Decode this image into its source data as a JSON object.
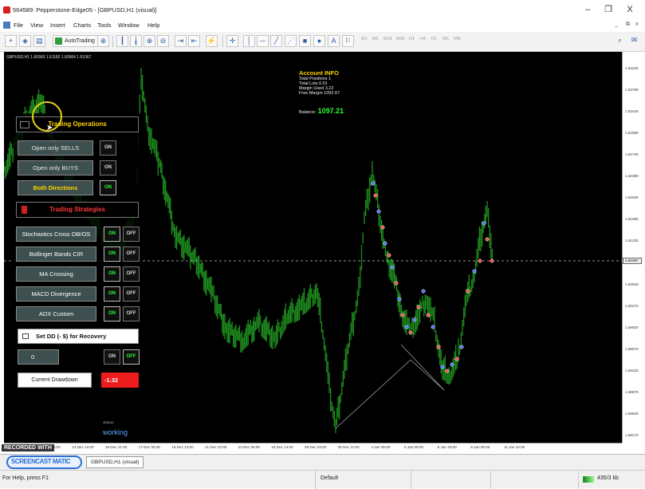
{
  "window": {
    "title": "564589: Pepperstone-Edge05 - [GBPUSD,H1 (visual)]",
    "minimize": "–",
    "restore": "❐",
    "close": "X"
  },
  "menu": {
    "items": [
      "File",
      "View",
      "Insert",
      "Charts",
      "Tools",
      "Window",
      "Help"
    ],
    "mdi": [
      "_",
      "&#8203;",
      "x"
    ]
  },
  "toolbar": {
    "autotrading_label": "AutoTrading",
    "timeframes": [
      "M1",
      "M5",
      "M15",
      "M30",
      "H1",
      "H4",
      "D1",
      "W1",
      "MN"
    ]
  },
  "chart": {
    "header": "GBPUSD,H1  1.60993 1.61182 1.60964 1.61067",
    "current_price": "1.61067",
    "price_ticks": [
      "1.64240",
      "1.63790",
      "1.63440",
      "1.63090",
      "1.62730",
      "1.62380",
      "1.62030",
      "1.61680",
      "1.61330",
      "1.60980",
      "1.60630",
      "1.60270",
      "1.59920",
      "1.59570",
      "1.59220",
      "1.58870",
      "1.58520",
      "1.58170"
    ],
    "time_ticks": [
      "10 Dec 2014",
      "11 Dec 06:00",
      "14 Dec 13:00",
      "16 Dec 21:00",
      "17 Dec 05:00",
      "18 Dec 13:00",
      "21 Dec 22:00",
      "23 Dec 06:00",
      "24 Dec 14:00",
      "29 Dec 03:00",
      "30 Dec 11:00",
      "4 Jan 05:00",
      "5 Jan 08:00",
      "6 Jan 16:00",
      "8 Jan 00:00",
      "11 Jan 10:00"
    ],
    "colors": {
      "candles": "#1e8f1e",
      "background": "#000000",
      "buy_marker": "#4a72ff",
      "sell_marker": "#ff4a4a"
    }
  },
  "account": {
    "title": "Account INFO",
    "lines": [
      "Total Positions 1",
      "Total Lots 0.01",
      "Margin Used 3.22",
      "Free Margin 1092.67"
    ],
    "balance_label": "Balance:",
    "balance_value": "1097.21"
  },
  "panel": {
    "trading_operations": "Trading Operations",
    "ops": [
      {
        "label": "Open only SELLS",
        "state": "ON",
        "active": false
      },
      {
        "label": "Open only BUYS",
        "state": "ON",
        "active": false
      },
      {
        "label": "Both Directions",
        "state": "ON",
        "active": true
      }
    ],
    "trading_strategies": "Trading Strategies",
    "strategies": [
      {
        "label": "Stochastics Cross OB/OS",
        "on": "ON",
        "off": "OFF"
      },
      {
        "label": "Bollinger Bands CIR",
        "on": "ON",
        "off": "OFF"
      },
      {
        "label": "MA Crossing",
        "on": "ON",
        "off": "OFF"
      },
      {
        "label": "MACD Divergence",
        "on": "ON",
        "off": "OFF"
      },
      {
        "label": "ADX Custom",
        "on": "ON",
        "off": "OFF"
      }
    ],
    "recovery_label": "Set DD (- $) for Recovery",
    "recovery_value": "0",
    "recovery_on": "ON",
    "recovery_off": "OFF",
    "drawdown_label": "Current Drawdown",
    "drawdown_value": "-1.32",
    "status_label": "Status",
    "status_value": "working"
  },
  "tabs": {
    "recorded": "RECORDED WITH",
    "tab_label": "GBPUSD,H1 (visual)",
    "watermark": "SCREENCAST  MATIC"
  },
  "statusbar": {
    "help": "For Help, press F1",
    "profile": "Default",
    "traffic": "435/3 kb"
  }
}
